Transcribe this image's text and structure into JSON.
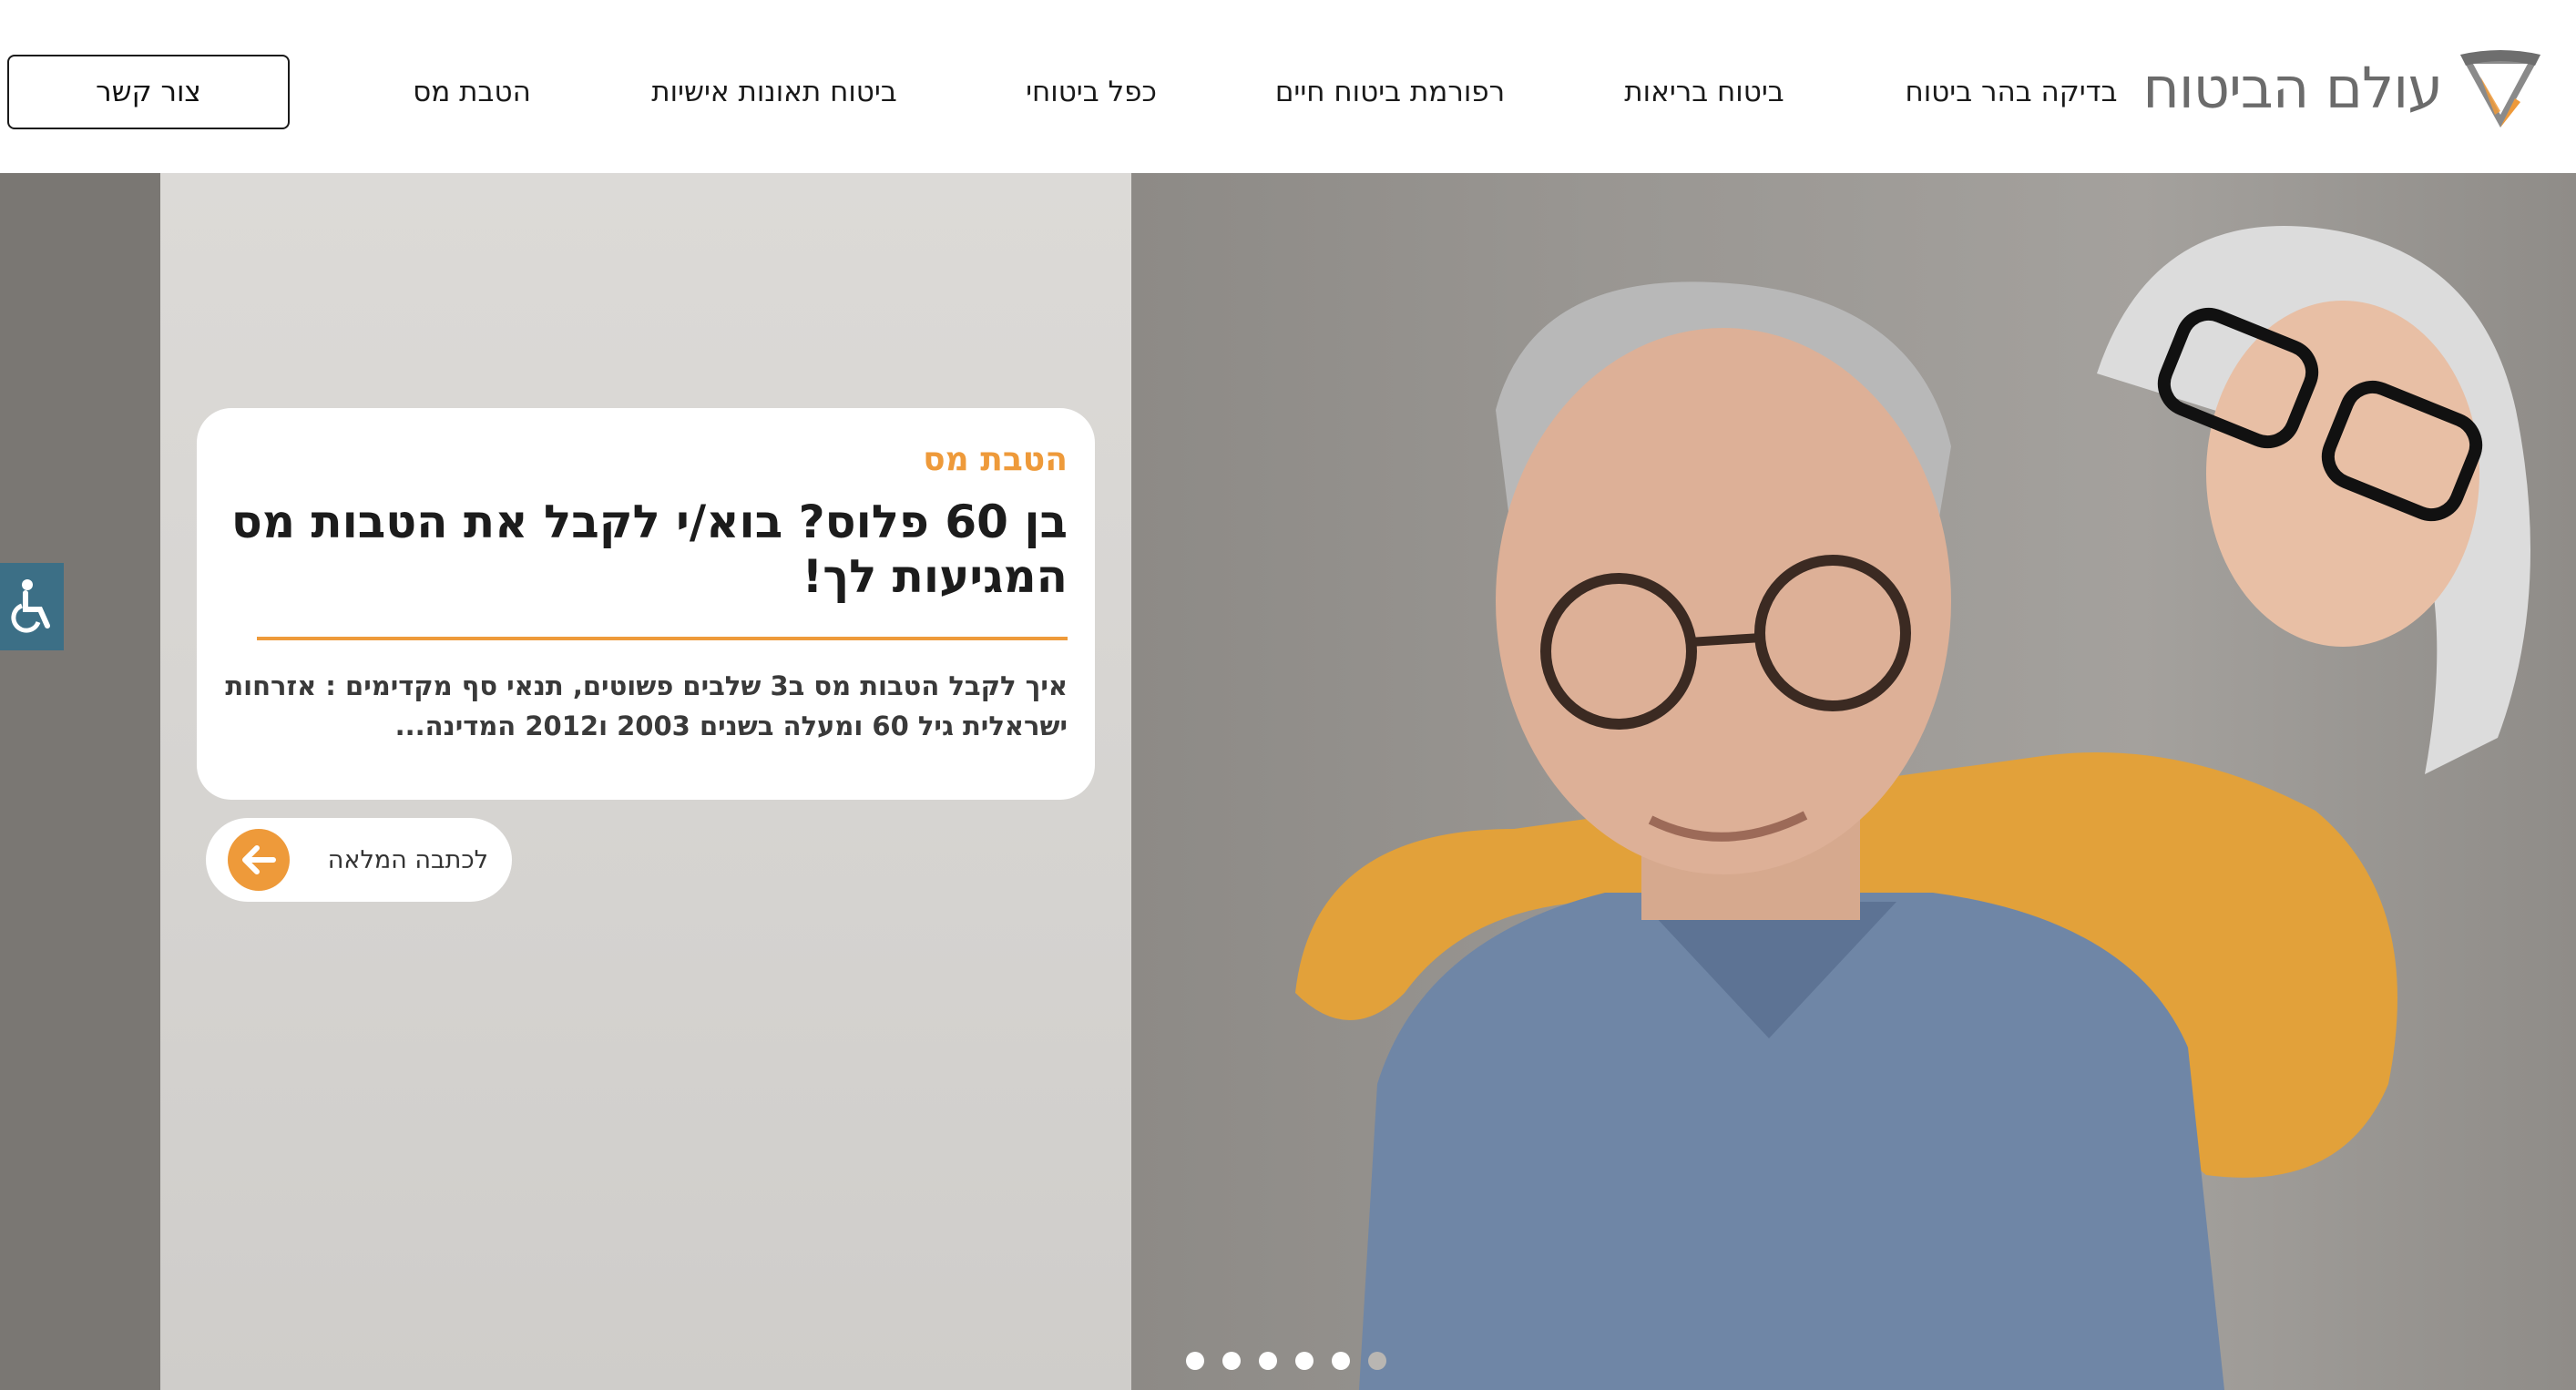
{
  "header": {
    "logo_text": "עולם הביטוח",
    "nav": [
      {
        "label": "בדיקה בהר ביטוח"
      },
      {
        "label": "ביטוח בריאות"
      },
      {
        "label": "רפורמת ביטוח חיים"
      },
      {
        "label": "כפל ביטוחי"
      },
      {
        "label": "ביטוח תאונות אישיות"
      },
      {
        "label": "הטבת מס"
      }
    ],
    "contact_label": "צור קשר"
  },
  "hero": {
    "card": {
      "category": "הטבת מס",
      "title": "בן 60 פלוס? בוא/י לקבל את הטבות מס המגיעות לך!",
      "excerpt": "איך לקבל הטבות מס ב3 שלבים פשוטים, תנאי סף מקדימים : אזרחות ישראלית גיל 60 ומעלה בשנים 2003 ו2012 המדינה..."
    },
    "read_more_label": "לכתבה המלאה",
    "slides_total": 6,
    "active_slide_index": 5
  },
  "colors": {
    "accent": "#ee9a3a",
    "accessibility": "#3c6f86",
    "text": "#1c1c1c"
  },
  "icons": {
    "logo": "shield-logo-icon",
    "accessibility": "wheelchair-icon",
    "read_more": "arrow-left-icon"
  }
}
